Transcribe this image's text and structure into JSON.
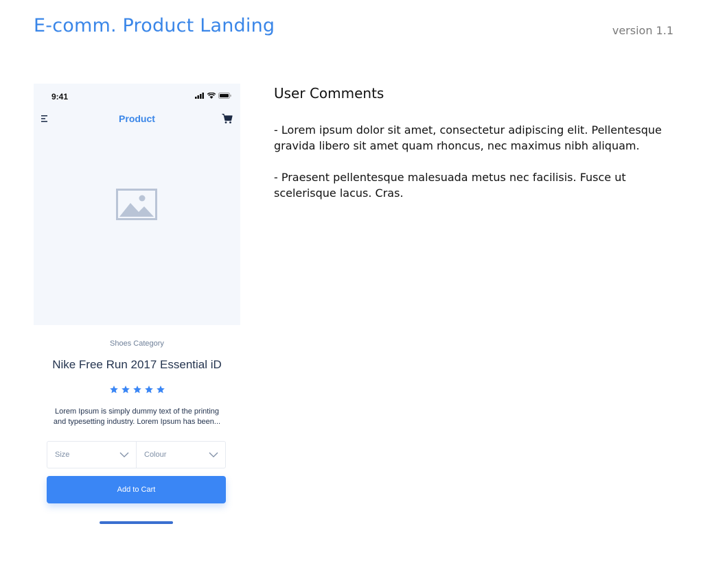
{
  "page": {
    "title": "E-comm. Product Landing",
    "version": "version 1.1"
  },
  "phone": {
    "status_time": "9:41",
    "header_title": "Product",
    "category": "Shoes Category",
    "product_name": "Nike Free Run 2017 Essential iD",
    "rating": 5,
    "rating_max": 5,
    "description": "Lorem Ipsum is simply dummy text of the printing and typesetting industry. Lorem Ipsum has been...",
    "size_select": "Size",
    "colour_select": "Colour",
    "add_to_cart": "Add to Cart"
  },
  "comments": {
    "title": "User Comments",
    "items": [
      "- Lorem ipsum dolor sit amet, consectetur adipiscing elit. Pellentesque gravida libero sit amet quam rhoncus, nec maximus nibh aliquam.",
      "- Praesent pellentesque malesuada metus nec facilisis. Fusce ut scelerisque lacus. Cras."
    ]
  },
  "colors": {
    "accent": "#3a86e8",
    "button": "#3a86f5",
    "star": "#3a86f5",
    "hero_bg": "#f4f7fc",
    "placeholder": "#b9c4d6"
  },
  "icons": [
    "menu-icon",
    "cart-icon",
    "image-placeholder-icon",
    "star-icon",
    "chevron-down-icon",
    "signal-icon",
    "wifi-icon",
    "battery-icon"
  ]
}
